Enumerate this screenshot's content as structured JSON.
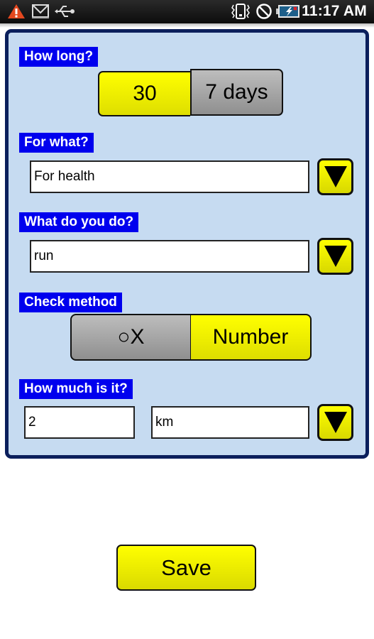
{
  "status_bar": {
    "left_icons": [
      "warning-icon",
      "gmail-icon",
      "usb-icon"
    ],
    "right_icons": [
      "vibrate-icon",
      "no-signal-icon",
      "battery-charging-icon"
    ],
    "time": "11:17 AM"
  },
  "form": {
    "how_long": {
      "label": "How long?",
      "options": [
        {
          "label": "30",
          "selected": true
        },
        {
          "label": "7 days",
          "selected": false
        }
      ]
    },
    "for_what": {
      "label": "For what?",
      "value": "For health"
    },
    "what_do_you_do": {
      "label": "What do you do?",
      "value": "run"
    },
    "check_method": {
      "label": "Check method",
      "options": [
        {
          "label": "○X",
          "selected": false
        },
        {
          "label": "Number",
          "selected": true
        }
      ]
    },
    "how_much": {
      "label": "How much is it?",
      "amount": "2",
      "unit": "km"
    }
  },
  "save_label": "Save",
  "colors": {
    "accent_yellow": "#ffff00",
    "label_blue": "#0000ee",
    "panel_bg": "#c6dbf1",
    "panel_border": "#0b1f5c"
  }
}
